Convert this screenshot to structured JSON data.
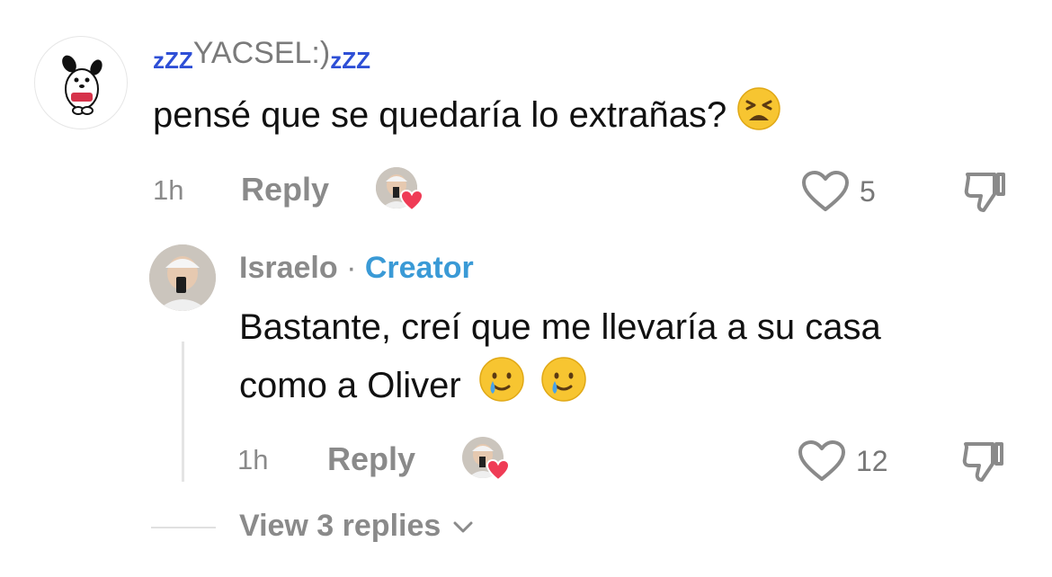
{
  "comment": {
    "username_prefix": "zZZ",
    "username_core": "YACSEL:)",
    "username_suffix": "zZZ",
    "text": "pensé que se quedaría lo extrañas?",
    "emoji": "tired-face",
    "time": "1h",
    "reply_label": "Reply",
    "like_count": "5"
  },
  "reply": {
    "username": "Israelo",
    "separator": "·",
    "badge": "Creator",
    "text_line1": "Bastante, creí que me llevaría a su casa",
    "text_line2": "como a Oliver",
    "emojis": [
      "smiling-face-with-tear",
      "smiling-face-with-tear"
    ],
    "time": "1h",
    "reply_label": "Reply",
    "like_count": "12"
  },
  "view_replies": "View 3 replies",
  "colors": {
    "creator": "#3a9ad6",
    "zzz": "#2e4fd6",
    "heart_badge": "#ef3b55"
  }
}
